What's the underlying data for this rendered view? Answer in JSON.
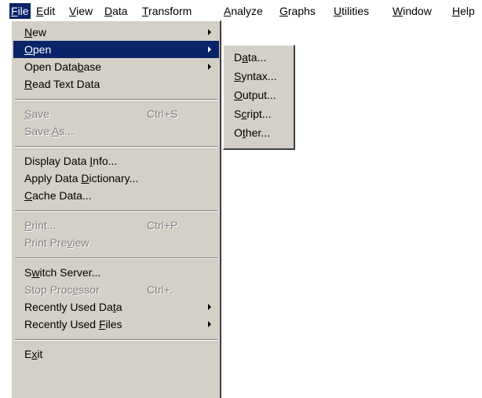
{
  "menubar": {
    "items": [
      {
        "pre": "",
        "u": "F",
        "post": "ile"
      },
      {
        "pre": "",
        "u": "E",
        "post": "dit"
      },
      {
        "pre": "",
        "u": "V",
        "post": "iew"
      },
      {
        "pre": "",
        "u": "D",
        "post": "ata"
      },
      {
        "pre": "",
        "u": "T",
        "post": "ransform"
      },
      {
        "pre": "",
        "u": "A",
        "post": "nalyze"
      },
      {
        "pre": "",
        "u": "G",
        "post": "raphs"
      },
      {
        "pre": "",
        "u": "U",
        "post": "tilities"
      },
      {
        "pre": "",
        "u": "W",
        "post": "indow"
      },
      {
        "pre": "",
        "u": "H",
        "post": "elp"
      }
    ]
  },
  "file_menu": {
    "new": {
      "pre": "",
      "u": "N",
      "post": "ew"
    },
    "open": {
      "pre": "",
      "u": "O",
      "post": "pen"
    },
    "open_database": {
      "pre": "Open Data",
      "u": "b",
      "post": "ase"
    },
    "read_text_data": {
      "pre": "",
      "u": "R",
      "post": "ead Text Data"
    },
    "save": {
      "pre": "",
      "u": "S",
      "post": "ave",
      "shortcut": "Ctrl+S"
    },
    "save_as": {
      "pre": "Save ",
      "u": "A",
      "post": "s..."
    },
    "display_data_info": {
      "pre": "Display Data ",
      "u": "I",
      "post": "nfo..."
    },
    "apply_data_dictionary": {
      "pre": "Apply Data ",
      "u": "D",
      "post": "ictionary..."
    },
    "cache_data": {
      "pre": "",
      "u": "C",
      "post": "ache Data..."
    },
    "print": {
      "pre": "",
      "u": "P",
      "post": "rint...",
      "shortcut": "Ctrl+P"
    },
    "print_preview": {
      "pre": "Print Pre",
      "u": "v",
      "post": "iew"
    },
    "switch_server": {
      "pre": "S",
      "u": "w",
      "post": "itch Server..."
    },
    "stop_processor": {
      "pre": "Stop Proc",
      "u": "e",
      "post": "ssor",
      "shortcut": "Ctrl+."
    },
    "recently_used_data": {
      "pre": "Recently Used Da",
      "u": "t",
      "post": "a"
    },
    "recently_used_files": {
      "pre": "Recently Used ",
      "u": "F",
      "post": "iles"
    },
    "exit": {
      "pre": "E",
      "u": "x",
      "post": "it"
    }
  },
  "open_submenu": {
    "data": {
      "pre": "D",
      "u": "a",
      "post": "ta..."
    },
    "syntax": {
      "pre": "",
      "u": "S",
      "post": "yntax..."
    },
    "output": {
      "pre": "",
      "u": "O",
      "post": "utput..."
    },
    "script": {
      "pre": "S",
      "u": "c",
      "post": "ript..."
    },
    "other": {
      "pre": "O",
      "u": "t",
      "post": "her..."
    }
  }
}
